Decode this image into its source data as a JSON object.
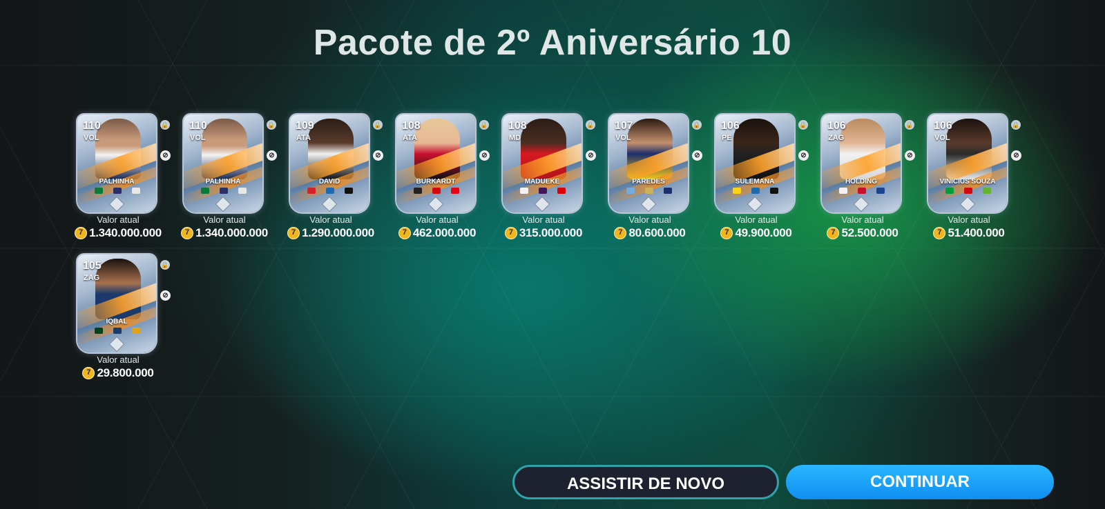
{
  "title": "Pacote de 2º Aniversário 10",
  "value_label": "Valor atual",
  "coin_icon": "fc-coin-icon",
  "cards": [
    {
      "rating": "110",
      "position": "VOL",
      "name": "PALHINHA",
      "value": "1.340.000.000"
    },
    {
      "rating": "110",
      "position": "VOL",
      "name": "PALHINHA",
      "value": "1.340.000.000"
    },
    {
      "rating": "109",
      "position": "ATA",
      "name": "DAVID",
      "value": "1.290.000.000"
    },
    {
      "rating": "108",
      "position": "ATA",
      "name": "BURKARDT",
      "value": "462.000.000"
    },
    {
      "rating": "108",
      "position": "MD",
      "name": "MADUEKE",
      "value": "315.000.000"
    },
    {
      "rating": "107",
      "position": "VOL",
      "name": "PAREDES",
      "value": "80.600.000"
    },
    {
      "rating": "106",
      "position": "PE",
      "name": "SULEMANA",
      "value": "49.900.000"
    },
    {
      "rating": "106",
      "position": "ZAG",
      "name": "HOLDING",
      "value": "52.500.000"
    },
    {
      "rating": "106",
      "position": "VOL",
      "name": "VINICIUS SOUZA",
      "value": "51.400.000"
    },
    {
      "rating": "105",
      "position": "ZAG",
      "name": "IQBAL",
      "value": "29.800.000"
    }
  ],
  "buttons": {
    "replay": "ASSISTIR DE NOVO",
    "continue": "CONTINUAR"
  },
  "colors": {
    "coin": "#f1b51f",
    "continue_button": "#1a9ff5",
    "replay_border": "#2fa3a8"
  }
}
